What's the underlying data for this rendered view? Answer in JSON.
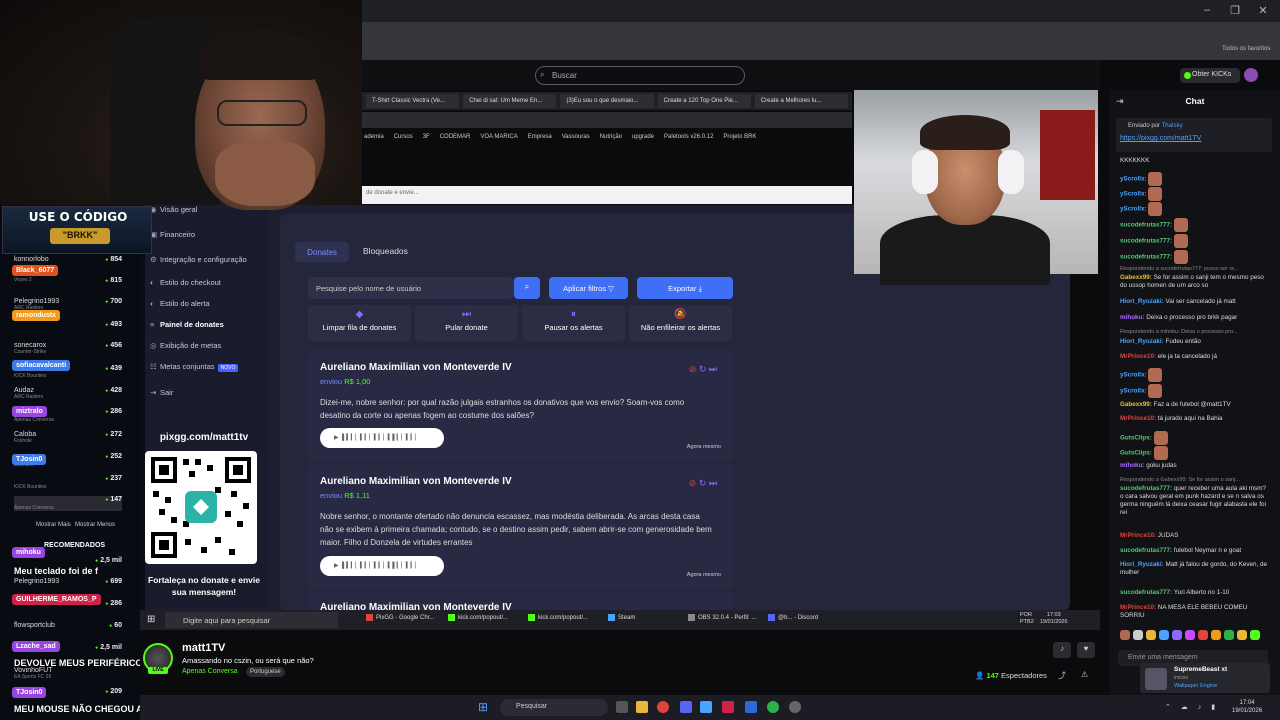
{
  "promo": {
    "line1": "USE O CÓDIGO",
    "line2": "\"BRKK\""
  },
  "browser": {
    "search_placeholder": "Buscar",
    "obter_label": "Obter KICKs",
    "favorites_label": "Todos os favoritos",
    "tabs": [
      "T-Shirt Classic Vectra (Ve...",
      "Chei di sal: Um Meme En...",
      "(3)Eu sou o que desmaio...",
      "Create a 120 Top One Pie...",
      "Create a Melhores lu..."
    ],
    "bookmarks": [
      "ademia",
      "Cursos",
      "3F",
      "CODEMAR",
      "VOA MARICA",
      "Empresa",
      "Vassouras",
      "Nutrição",
      "upgrade",
      "Paletools v26.0.12",
      "Projeto BRK"
    ],
    "partial_notice": "de donate e envie..."
  },
  "left_chat": {
    "rows": [
      {
        "name": "konnorlobo",
        "count": "854"
      },
      {
        "name": "",
        "sub": "Vezes 2",
        "count": "815"
      },
      {
        "name": "Pelegrino1993",
        "sub": "ARC Raiders",
        "count": "700"
      },
      {
        "name": "",
        "sub": "",
        "count": "493"
      },
      {
        "name": "sonecarox",
        "sub": "Counter-Strike",
        "count": "456"
      },
      {
        "name": "",
        "sub": "KICK Bounties",
        "count": "439"
      },
      {
        "name": "Audaz",
        "sub": "ARC Raiders",
        "count": "428"
      },
      {
        "name": "",
        "sub": "Apenas Conversa",
        "count": "286"
      },
      {
        "name": "Caloba",
        "sub": "Foxhole",
        "count": "272"
      },
      {
        "name": "",
        "sub": "Bounties",
        "count": "252"
      },
      {
        "name": "",
        "sub": "KICK Bounties",
        "count": "237"
      },
      {
        "name": "",
        "sub": "Apenas Conversa",
        "count": "147"
      }
    ],
    "chips": [
      {
        "text": "Black_6077",
        "color": "#e0531f"
      },
      {
        "text": "ramondustx",
        "color": "#f29a1a"
      },
      {
        "text": "sofiacavalcanti",
        "color": "#3d7be6"
      },
      {
        "text": "miztralo",
        "color": "#9b45e0"
      },
      {
        "text": "TJosin0",
        "color": "#3d7be6"
      },
      {
        "text": "mihoku",
        "color": "#9b45e0"
      },
      {
        "text": "GUILHERME_RAMOS_P",
        "color": "#d1224b"
      },
      {
        "text": "Lzache_sad",
        "color": "#9b45e0"
      },
      {
        "text": "TJosin0",
        "color": "#9b45e0"
      }
    ],
    "mostrar_mais": "Mostrar Mais",
    "mostrar_menos": "Mostrar Menos",
    "recomendados": "RECOMENDADOS",
    "rec_rows": [
      {
        "name": "",
        "count": "2,5 mil"
      },
      {
        "name": "Pelegrino1993",
        "count": "699"
      },
      {
        "name": "",
        "count": "286"
      },
      {
        "name": "flowsportclub",
        "count": "60"
      },
      {
        "name": "",
        "count": "2,5 mil"
      },
      {
        "name": "VovinhoFUT",
        "sub": "EA Sports FC 26",
        "count": ""
      },
      {
        "name": "",
        "count": "209"
      }
    ],
    "messages": [
      "Meu teclado foi de f",
      "DEVOLVE MEUS PERIFÉRICOS",
      "MEU MOUSE NÃO CHEGOU ATÉ HJ"
    ]
  },
  "sidebar": {
    "items": [
      {
        "label": "Visão geral",
        "icon": "eye-icon"
      },
      {
        "label": "Financeiro",
        "icon": "wallet-icon"
      },
      {
        "label": "Integração e configuração",
        "icon": "gear-icon"
      },
      {
        "label": "Estilo do checkout",
        "icon": "palette-icon"
      },
      {
        "label": "Estilo do alerta",
        "icon": "palette-icon"
      },
      {
        "label": "Painel de donates",
        "icon": "list-icon"
      },
      {
        "label": "Exibição de metas",
        "icon": "target-icon"
      },
      {
        "label": "Metas conjuntas",
        "icon": "group-icon",
        "badge": "NOVO"
      },
      {
        "label": "Sair",
        "icon": "logout-icon"
      }
    ],
    "pix_url": "pixgg.com/matt1tv",
    "pix_text": "Fortaleça no donate e envie sua mensagem!"
  },
  "panel": {
    "tabs": [
      "Donates",
      "Bloqueados"
    ],
    "search_placeholder": "Pesquise pelo nome de usuário",
    "filters_label": "Aplicar filtros",
    "export_label": "Exportar",
    "actions": [
      "Limpar fila de donates",
      "Pular donate",
      "Pausar os alertas",
      "Não enfileirar os alertas"
    ],
    "cards": [
      {
        "name": "Aureliano Maximilian von Monteverde IV",
        "sent": "enviou",
        "amount": "R$ 1,00",
        "message": "Dizei-me, nobre senhor: por qual razão julgais estranhos os donativos que vos envio? Soam-vos como desatino da corte ou apenas fogem ao costume dos salões?",
        "time": "Agora mesmo"
      },
      {
        "name": "Aureliano Maximilian von Monteverde IV",
        "sent": "enviou",
        "amount": "R$ 1,11",
        "message": "Nobre senhor, o montante ofertado não denuncia escassez, mas modéstia deliberada. As arcas desta casa não se exibem à primeira chamada; contudo, se o destino assim pedir, sabem abrir-se com generosidade bem maior. Filho d Donzela de virtudes errantes",
        "time": "Agora mesmo"
      },
      {
        "name": "Aureliano Maximilian von Monteverde IV"
      }
    ]
  },
  "inner_taskbar": {
    "search": "Digite aqui para pesquisar",
    "apps": [
      {
        "label": "PixGG - Google Chr...",
        "color": "#e0443a"
      },
      {
        "label": "kick.com/popout/...",
        "color": "#53fc18"
      },
      {
        "label": "kick.com/popout/...",
        "color": "#53fc18"
      },
      {
        "label": "Steam",
        "color": "#4aa3ff"
      },
      {
        "label": "OBS 32.0.4 - Perfil: ...",
        "color": "#888"
      },
      {
        "label": "@b... - Discord",
        "color": "#5865f2"
      }
    ],
    "lang": "POR",
    "lang2": "PTB2",
    "time": "17:03",
    "date": "19/01/2026"
  },
  "stream": {
    "name": "matt1TV",
    "title": "Amassando no cszin, ou será que não?",
    "category": "Apenas Conversa",
    "tag": "Portuguese",
    "live": "LIVE",
    "viewers": "147",
    "viewers_label": "Espectadores"
  },
  "chat": {
    "title": "Chat",
    "pinned_by_label": "Enviado por",
    "pinned_by": "Thatsky",
    "pinned_url": "https://pixgg.com/matt1TV",
    "messages": [
      {
        "type": "plain",
        "text": "KKKKKKK"
      },
      {
        "user": "yScrollx:",
        "color": "#4aa3ff",
        "text": "",
        "emote": true
      },
      {
        "user": "yScrollx:",
        "color": "#4aa3ff",
        "text": "",
        "emote": true
      },
      {
        "user": "yScrollx:",
        "color": "#4aa3ff",
        "text": "",
        "emote": true
      },
      {
        "user": "sucodefrutas777:",
        "color": "#53c96f",
        "text": "",
        "emote": true
      },
      {
        "user": "sucodefrutas777:",
        "color": "#53c96f",
        "text": "",
        "emote": true
      },
      {
        "user": "sucodefrutas777:",
        "color": "#53c96f",
        "text": "",
        "emote": true
      },
      {
        "type": "reply",
        "text": "Respondendo a sucodefrutas777: posso ser re..."
      },
      {
        "user": "Gabexx99:",
        "color": "#e3c23a",
        "text": "Se for assim o sanji tem o mesmo peso do ussop homen de um arco so"
      },
      {
        "user": "Hiori_Ryuzaki:",
        "color": "#4aa3ff",
        "text": "Vai ser cancelado já matt"
      },
      {
        "user": "mihoku:",
        "color": "#b06bff",
        "text": "Deixa o processo pro brkk pagar"
      },
      {
        "type": "reply",
        "text": "Respondendo a mihoku: Deixa o processo pro..."
      },
      {
        "user": "Hiori_Ryuzaki:",
        "color": "#4aa3ff",
        "text": "Fudeu então"
      },
      {
        "user": "MrPrince10:",
        "color": "#e0443a",
        "text": "ele ja ta cancelado já"
      },
      {
        "user": "yScrollx:",
        "color": "#4aa3ff",
        "text": "",
        "emote": true
      },
      {
        "user": "yScrollx:",
        "color": "#4aa3ff",
        "text": "",
        "emote": true
      },
      {
        "user": "Gabexx99:",
        "color": "#e3c23a",
        "text": "Faz a de futebol @matt1TV"
      },
      {
        "user": "MrPrince10:",
        "color": "#e0443a",
        "text": "tá jurado aqui na Bahia"
      },
      {
        "user": "GutsClips:",
        "color": "#53c96f",
        "text": "",
        "emote": true
      },
      {
        "user": "GutsClips:",
        "color": "#53c96f",
        "text": "",
        "emote": true
      },
      {
        "user": "mihoku:",
        "color": "#b06bff",
        "text": "goku judas"
      },
      {
        "type": "reply",
        "text": "Respondendo a Gabexx99: Se for assim o sanj..."
      },
      {
        "user": "sucodefrutas777:",
        "color": "#53c96f",
        "text": "quer receber uma aula aki msm? o cara salvou geral em punk hazard e se n salva os germa ninguém lá deixa ceasar fugir alabasta ele foi rei"
      },
      {
        "user": "MrPrince10:",
        "color": "#e0443a",
        "text": "JUDAS"
      },
      {
        "user": "sucodefrutas777:",
        "color": "#53c96f",
        "text": "futebol Neymar n e goat"
      },
      {
        "user": "Hiori_Ryuzaki:",
        "color": "#4aa3ff",
        "text": "Matt já falou de gordo, do Keven, de mulher"
      },
      {
        "user": "sucodefrutas777:",
        "color": "#53c96f",
        "text": "Yuri Alberto no 1-10"
      },
      {
        "user": "MrPrince10:",
        "color": "#e0443a",
        "text": "NA MESA ELE BEBEU COMEU SORRIU"
      }
    ],
    "input_placeholder": "Envie uma mensagem",
    "toast_title": "SupremeBeast xt",
    "toast_sub": "iniciou",
    "toast_app": "Wallpaper Engine"
  },
  "taskbar": {
    "search": "Pesquisar",
    "time": "17:04",
    "date": "19/01/2026"
  }
}
